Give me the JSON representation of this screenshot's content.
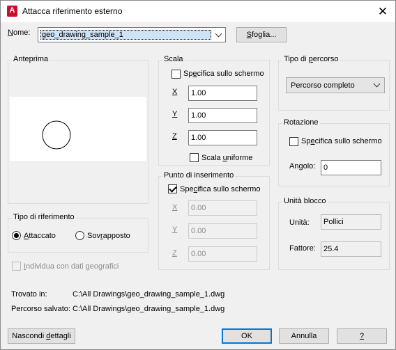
{
  "window": {
    "title": "Attacca riferimento esterno",
    "app_icon_letter": "A"
  },
  "name": {
    "label_u": "N",
    "label_rest": "ome:",
    "value": "geo_drawing_sample_1",
    "browse_u": "S",
    "browse_rest": "foglia..."
  },
  "preview": {
    "title": "Anteprima"
  },
  "scale": {
    "title": "Scala",
    "specify_u": "e",
    "specify_pre": "Sp",
    "specify_post": "cifica sullo schermo",
    "x_label": "X",
    "x_value": "1.00",
    "y_label": "Y",
    "y_value": "1.00",
    "z_label": "Z",
    "z_value": "1.00",
    "uniform_pre": "Scala ",
    "uniform_u": "u",
    "uniform_post": "niforme"
  },
  "path_type": {
    "title_pre": "Tipo di ",
    "title_u": "p",
    "title_post": "ercorso",
    "value": "Percorso completo"
  },
  "insertion": {
    "title": "Punto di inserimento",
    "specify_pre": "Spe",
    "specify_u": "c",
    "specify_post": "ifica sullo schermo",
    "x_label": "X",
    "x_value": "0.00",
    "y_label": "Y",
    "y_value": "0.00",
    "z_label": "Z",
    "z_value": "0.00"
  },
  "rotation": {
    "title": "Rotazione",
    "specify_pre": "Sp",
    "specify_u": "e",
    "specify_post": "cifica sullo schermo",
    "angle_pre": "An",
    "angle_u": "g",
    "angle_post": "olo:",
    "angle_value": "0"
  },
  "units": {
    "title": "Unità blocco",
    "unit_label": "Unità:",
    "unit_value": "Pollici",
    "factor_label": "Fattore:",
    "factor_value": "25.4"
  },
  "ref_type": {
    "title": "Tipo di riferimento",
    "attached_u": "A",
    "attached_rest": "ttaccato",
    "overlay_pre": "Sov",
    "overlay_u": "r",
    "overlay_post": "apposto"
  },
  "geo": {
    "label_pre": "",
    "label_u": "I",
    "label_post": "ndividua con dati geografici"
  },
  "found_in": {
    "label": "Trovato in:",
    "value": "C:\\All Drawings\\geo_drawing_sample_1.dwg"
  },
  "saved_path": {
    "label": "Percorso salvato:",
    "value": "C:\\All Drawings\\geo_drawing_sample_1.dwg"
  },
  "buttons": {
    "hide_pre": "Nascondi ",
    "hide_u": "d",
    "hide_post": "ettagli",
    "ok": "OK",
    "cancel": "Annulla",
    "help": "?"
  },
  "colors": {
    "accent": "#0078d7",
    "app_icon": "#c8102e"
  },
  "icons": [
    "autocad-app-icon",
    "close-icon",
    "chevron-down-icon",
    "checkbox-check-icon",
    "circle-preview"
  ]
}
